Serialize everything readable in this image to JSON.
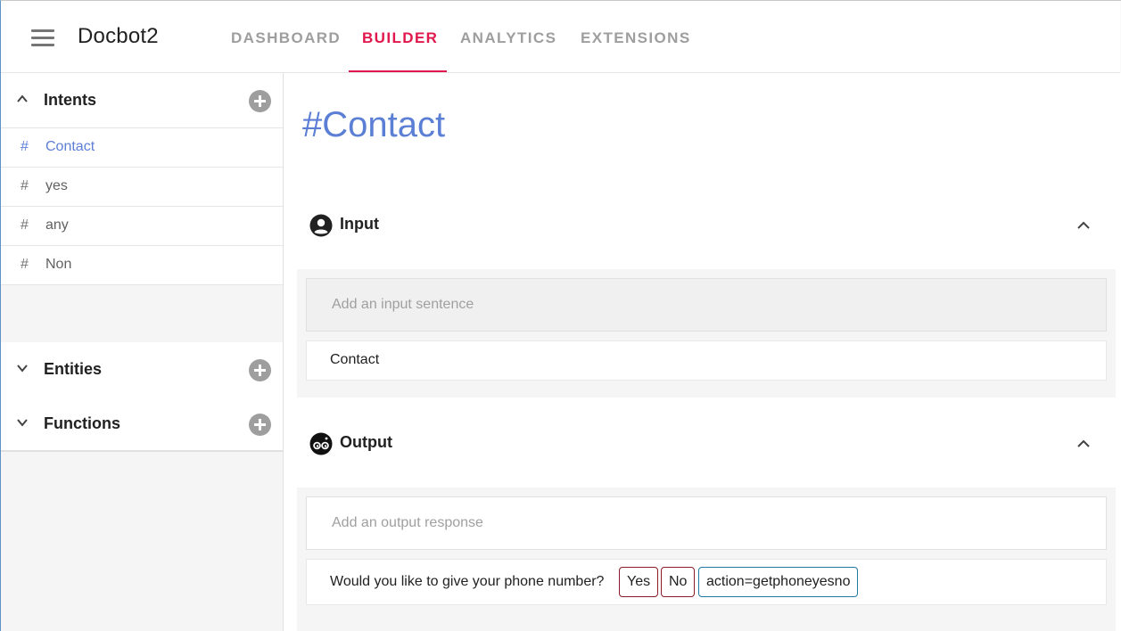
{
  "app": {
    "title": "Docbot2"
  },
  "nav": {
    "tabs": [
      {
        "label": "DASHBOARD",
        "active": false
      },
      {
        "label": "BUILDER",
        "active": true
      },
      {
        "label": "ANALYTICS",
        "active": false
      },
      {
        "label": "EXTENSIONS",
        "active": false
      }
    ]
  },
  "sidebar": {
    "intents": {
      "title": "Intents",
      "expanded": true,
      "items": [
        {
          "label": "Contact",
          "active": true
        },
        {
          "label": "yes",
          "active": false
        },
        {
          "label": "any",
          "active": false
        },
        {
          "label": "Non",
          "active": false
        }
      ]
    },
    "entities": {
      "title": "Entities",
      "expanded": false
    },
    "functions": {
      "title": "Functions",
      "expanded": false
    },
    "hash_symbol": "#"
  },
  "main": {
    "title": "#Contact",
    "input": {
      "title": "Input",
      "icon": "user-circle-icon",
      "placeholder": "Add an input sentence",
      "sentences": [
        "Contact"
      ]
    },
    "output": {
      "title": "Output",
      "icon": "bot-eyes-icon",
      "placeholder": "Add an output response",
      "responses": [
        {
          "text": "Would you like to give your phone number?",
          "buttons": [
            "Yes",
            "No"
          ],
          "action": "action=getphoneyesno"
        }
      ]
    }
  },
  "colors": {
    "accent": "#e0174c",
    "link": "#5c7fd6",
    "chip_button_border": "#8b1a2b",
    "chip_action_border": "#1f7aa3"
  }
}
